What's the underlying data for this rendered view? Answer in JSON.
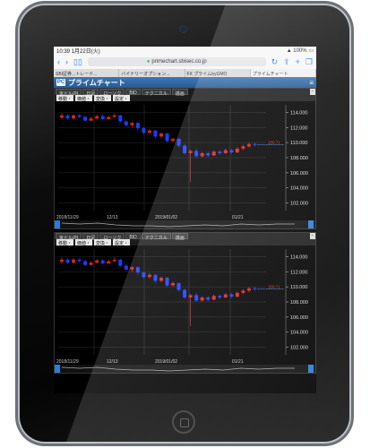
{
  "status_bar": {
    "time": "10:39",
    "date": "1月22日(火)",
    "battery": "100%"
  },
  "browser": {
    "url": "primechart.sbisec.co.jp",
    "tabs": [
      "SBI証券...トレード...",
      "バイナリーオプション...",
      "FX プライムbyGMO",
      "プライムチャート"
    ]
  },
  "site": {
    "logo": "PC",
    "title": "プライムチャート",
    "menu_icon": "hamburger-icon"
  },
  "panel_tabs": [
    "米ドル/円",
    "日足",
    "ローソク",
    "BID",
    "テクニカル",
    "描画"
  ],
  "panel_options": [
    "移動・",
    "価値・",
    "変換・",
    "設定・"
  ],
  "chart_data": [
    {
      "type": "candlestick",
      "ylim": [
        101,
        115
      ],
      "y_ticks": [
        "102.000",
        "104.000",
        "106.000",
        "108.000",
        "110.000",
        "112.000",
        "114.000"
      ],
      "x_labels": [
        "2018/11/29",
        "12/13",
        "2019/01/02",
        "01/21"
      ],
      "price_label": "109.71",
      "candles": [
        {
          "o": 113.3,
          "c": 113.6,
          "h": 113.9,
          "l": 113.1
        },
        {
          "o": 113.6,
          "c": 113.2,
          "h": 113.8,
          "l": 113.0
        },
        {
          "o": 113.2,
          "c": 113.6,
          "h": 113.8,
          "l": 113.0
        },
        {
          "o": 113.6,
          "c": 113.4,
          "h": 113.8,
          "l": 113.2
        },
        {
          "o": 113.4,
          "c": 112.9,
          "h": 113.6,
          "l": 112.7
        },
        {
          "o": 112.9,
          "c": 113.2,
          "h": 113.4,
          "l": 112.8
        },
        {
          "o": 113.2,
          "c": 113.5,
          "h": 113.7,
          "l": 113.1
        },
        {
          "o": 113.5,
          "c": 113.1,
          "h": 113.7,
          "l": 112.9
        },
        {
          "o": 113.1,
          "c": 113.4,
          "h": 113.6,
          "l": 113.0
        },
        {
          "o": 113.4,
          "c": 113.6,
          "h": 113.9,
          "l": 113.3
        },
        {
          "o": 113.6,
          "c": 112.8,
          "h": 113.7,
          "l": 112.6
        },
        {
          "o": 112.8,
          "c": 112.3,
          "h": 113.0,
          "l": 112.1
        },
        {
          "o": 112.3,
          "c": 112.6,
          "h": 112.8,
          "l": 112.0
        },
        {
          "o": 112.6,
          "c": 111.9,
          "h": 112.7,
          "l": 111.6
        },
        {
          "o": 111.9,
          "c": 111.3,
          "h": 112.0,
          "l": 111.1
        },
        {
          "o": 111.3,
          "c": 111.6,
          "h": 111.8,
          "l": 111.1
        },
        {
          "o": 111.6,
          "c": 110.8,
          "h": 111.7,
          "l": 110.5
        },
        {
          "o": 110.8,
          "c": 111.2,
          "h": 111.4,
          "l": 110.6
        },
        {
          "o": 111.2,
          "c": 110.2,
          "h": 111.3,
          "l": 110.0
        },
        {
          "o": 110.2,
          "c": 110.5,
          "h": 110.7,
          "l": 110.0
        },
        {
          "o": 110.5,
          "c": 109.6,
          "h": 110.6,
          "l": 109.4
        },
        {
          "o": 109.6,
          "c": 108.6,
          "h": 109.8,
          "l": 108.4
        },
        {
          "o": 108.6,
          "c": 108.9,
          "h": 109.1,
          "l": 104.8
        },
        {
          "o": 108.9,
          "c": 108.2,
          "h": 109.2,
          "l": 108.0
        },
        {
          "o": 108.2,
          "c": 108.6,
          "h": 108.8,
          "l": 108.0
        },
        {
          "o": 108.6,
          "c": 108.3,
          "h": 108.8,
          "l": 108.1
        },
        {
          "o": 108.3,
          "c": 108.8,
          "h": 109.0,
          "l": 108.2
        },
        {
          "o": 108.8,
          "c": 108.6,
          "h": 109.0,
          "l": 108.4
        },
        {
          "o": 108.6,
          "c": 109.0,
          "h": 109.2,
          "l": 108.5
        },
        {
          "o": 109.0,
          "c": 108.7,
          "h": 109.2,
          "l": 108.5
        },
        {
          "o": 108.7,
          "c": 109.2,
          "h": 109.4,
          "l": 108.6
        },
        {
          "o": 109.2,
          "c": 109.5,
          "h": 109.7,
          "l": 109.0
        },
        {
          "o": 109.5,
          "c": 109.8,
          "h": 110.0,
          "l": 109.3
        },
        {
          "o": 109.8,
          "c": 109.7,
          "h": 110.0,
          "l": 109.5
        }
      ]
    },
    {
      "type": "candlestick",
      "ylim": [
        101,
        115
      ],
      "y_ticks": [
        "102.000",
        "104.000",
        "106.000",
        "108.000",
        "110.000",
        "112.000",
        "114.000"
      ],
      "x_labels": [
        "2018/11/29",
        "12/13",
        "2019/01/02",
        "01/21"
      ],
      "price_label": "109.71",
      "candles_same_as_first": true
    }
  ]
}
